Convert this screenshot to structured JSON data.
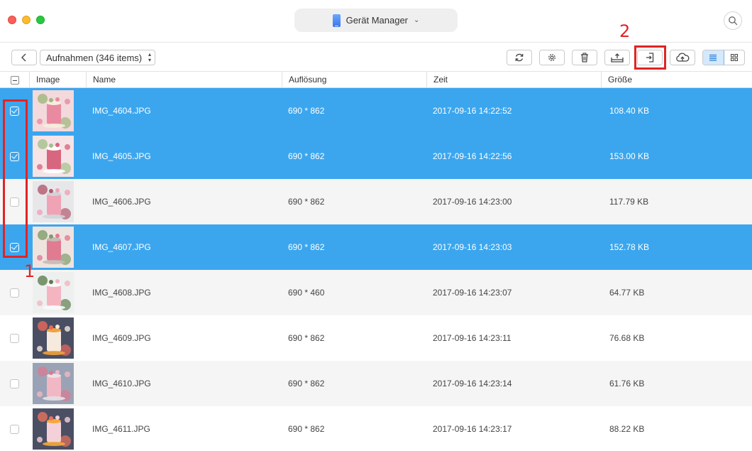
{
  "window": {
    "device_selector_label": "Gerät Manager",
    "chevron_icon": "chevron-down-icon",
    "search_icon": "search-icon"
  },
  "toolbar": {
    "album_select_value": "Aufnahmen (346 items)",
    "buttons": [
      "back-icon",
      "refresh-icon",
      "settings-icon",
      "trash-icon",
      "export-to-computer-icon",
      "send-to-device-icon",
      "cloud-upload-icon",
      "list-view-icon",
      "grid-view-icon"
    ]
  },
  "annotations": {
    "step1": "1",
    "step2": "2",
    "color": "#e02424"
  },
  "table": {
    "columns": {
      "image": "Image",
      "name": "Name",
      "resolution": "Auflösung",
      "time": "Zeit",
      "size": "Größe"
    },
    "rows": [
      {
        "name": "IMG_4604.JPG",
        "resolution": "690 * 862",
        "time": "2017-09-16 14:22:52",
        "size": "108.40 KB",
        "checked": true
      },
      {
        "name": "IMG_4605.JPG",
        "resolution": "690 * 862",
        "time": "2017-09-16 14:22:56",
        "size": "153.00 KB",
        "checked": true
      },
      {
        "name": "IMG_4606.JPG",
        "resolution": "690 * 862",
        "time": "2017-09-16 14:23:00",
        "size": "117.79 KB",
        "checked": false
      },
      {
        "name": "IMG_4607.JPG",
        "resolution": "690 * 862",
        "time": "2017-09-16 14:23:03",
        "size": "152.78 KB",
        "checked": true
      },
      {
        "name": "IMG_4608.JPG",
        "resolution": "690 * 460",
        "time": "2017-09-16 14:23:07",
        "size": "64.77 KB",
        "checked": false
      },
      {
        "name": "IMG_4609.JPG",
        "resolution": "690 * 862",
        "time": "2017-09-16 14:23:11",
        "size": "76.68 KB",
        "checked": false
      },
      {
        "name": "IMG_4610.JPG",
        "resolution": "690 * 862",
        "time": "2017-09-16 14:23:14",
        "size": "61.76 KB",
        "checked": false
      },
      {
        "name": "IMG_4611.JPG",
        "resolution": "690 * 862",
        "time": "2017-09-16 14:23:17",
        "size": "88.22 KB",
        "checked": false
      }
    ]
  },
  "colors": {
    "selection": "#3ba6ee",
    "alt_row": "#f5f5f5",
    "accent": "#3b76e8"
  }
}
